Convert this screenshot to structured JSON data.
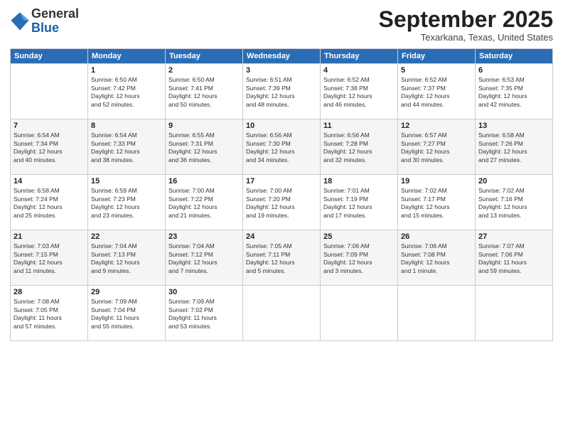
{
  "header": {
    "logo_line1": "General",
    "logo_line2": "Blue",
    "month_title": "September 2025",
    "subtitle": "Texarkana, Texas, United States"
  },
  "days_of_week": [
    "Sunday",
    "Monday",
    "Tuesday",
    "Wednesday",
    "Thursday",
    "Friday",
    "Saturday"
  ],
  "weeks": [
    [
      {
        "day": "",
        "info": ""
      },
      {
        "day": "1",
        "info": "Sunrise: 6:50 AM\nSunset: 7:42 PM\nDaylight: 12 hours\nand 52 minutes."
      },
      {
        "day": "2",
        "info": "Sunrise: 6:50 AM\nSunset: 7:41 PM\nDaylight: 12 hours\nand 50 minutes."
      },
      {
        "day": "3",
        "info": "Sunrise: 6:51 AM\nSunset: 7:39 PM\nDaylight: 12 hours\nand 48 minutes."
      },
      {
        "day": "4",
        "info": "Sunrise: 6:52 AM\nSunset: 7:38 PM\nDaylight: 12 hours\nand 46 minutes."
      },
      {
        "day": "5",
        "info": "Sunrise: 6:52 AM\nSunset: 7:37 PM\nDaylight: 12 hours\nand 44 minutes."
      },
      {
        "day": "6",
        "info": "Sunrise: 6:53 AM\nSunset: 7:35 PM\nDaylight: 12 hours\nand 42 minutes."
      }
    ],
    [
      {
        "day": "7",
        "info": "Sunrise: 6:54 AM\nSunset: 7:34 PM\nDaylight: 12 hours\nand 40 minutes."
      },
      {
        "day": "8",
        "info": "Sunrise: 6:54 AM\nSunset: 7:33 PM\nDaylight: 12 hours\nand 38 minutes."
      },
      {
        "day": "9",
        "info": "Sunrise: 6:55 AM\nSunset: 7:31 PM\nDaylight: 12 hours\nand 36 minutes."
      },
      {
        "day": "10",
        "info": "Sunrise: 6:56 AM\nSunset: 7:30 PM\nDaylight: 12 hours\nand 34 minutes."
      },
      {
        "day": "11",
        "info": "Sunrise: 6:56 AM\nSunset: 7:28 PM\nDaylight: 12 hours\nand 32 minutes."
      },
      {
        "day": "12",
        "info": "Sunrise: 6:57 AM\nSunset: 7:27 PM\nDaylight: 12 hours\nand 30 minutes."
      },
      {
        "day": "13",
        "info": "Sunrise: 6:58 AM\nSunset: 7:26 PM\nDaylight: 12 hours\nand 27 minutes."
      }
    ],
    [
      {
        "day": "14",
        "info": "Sunrise: 6:58 AM\nSunset: 7:24 PM\nDaylight: 12 hours\nand 25 minutes."
      },
      {
        "day": "15",
        "info": "Sunrise: 6:59 AM\nSunset: 7:23 PM\nDaylight: 12 hours\nand 23 minutes."
      },
      {
        "day": "16",
        "info": "Sunrise: 7:00 AM\nSunset: 7:22 PM\nDaylight: 12 hours\nand 21 minutes."
      },
      {
        "day": "17",
        "info": "Sunrise: 7:00 AM\nSunset: 7:20 PM\nDaylight: 12 hours\nand 19 minutes."
      },
      {
        "day": "18",
        "info": "Sunrise: 7:01 AM\nSunset: 7:19 PM\nDaylight: 12 hours\nand 17 minutes."
      },
      {
        "day": "19",
        "info": "Sunrise: 7:02 AM\nSunset: 7:17 PM\nDaylight: 12 hours\nand 15 minutes."
      },
      {
        "day": "20",
        "info": "Sunrise: 7:02 AM\nSunset: 7:16 PM\nDaylight: 12 hours\nand 13 minutes."
      }
    ],
    [
      {
        "day": "21",
        "info": "Sunrise: 7:03 AM\nSunset: 7:15 PM\nDaylight: 12 hours\nand 11 minutes."
      },
      {
        "day": "22",
        "info": "Sunrise: 7:04 AM\nSunset: 7:13 PM\nDaylight: 12 hours\nand 9 minutes."
      },
      {
        "day": "23",
        "info": "Sunrise: 7:04 AM\nSunset: 7:12 PM\nDaylight: 12 hours\nand 7 minutes."
      },
      {
        "day": "24",
        "info": "Sunrise: 7:05 AM\nSunset: 7:11 PM\nDaylight: 12 hours\nand 5 minutes."
      },
      {
        "day": "25",
        "info": "Sunrise: 7:06 AM\nSunset: 7:09 PM\nDaylight: 12 hours\nand 3 minutes."
      },
      {
        "day": "26",
        "info": "Sunrise: 7:06 AM\nSunset: 7:08 PM\nDaylight: 12 hours\nand 1 minute."
      },
      {
        "day": "27",
        "info": "Sunrise: 7:07 AM\nSunset: 7:06 PM\nDaylight: 11 hours\nand 59 minutes."
      }
    ],
    [
      {
        "day": "28",
        "info": "Sunrise: 7:08 AM\nSunset: 7:05 PM\nDaylight: 11 hours\nand 57 minutes."
      },
      {
        "day": "29",
        "info": "Sunrise: 7:09 AM\nSunset: 7:04 PM\nDaylight: 11 hours\nand 55 minutes."
      },
      {
        "day": "30",
        "info": "Sunrise: 7:09 AM\nSunset: 7:02 PM\nDaylight: 11 hours\nand 53 minutes."
      },
      {
        "day": "",
        "info": ""
      },
      {
        "day": "",
        "info": ""
      },
      {
        "day": "",
        "info": ""
      },
      {
        "day": "",
        "info": ""
      }
    ]
  ]
}
